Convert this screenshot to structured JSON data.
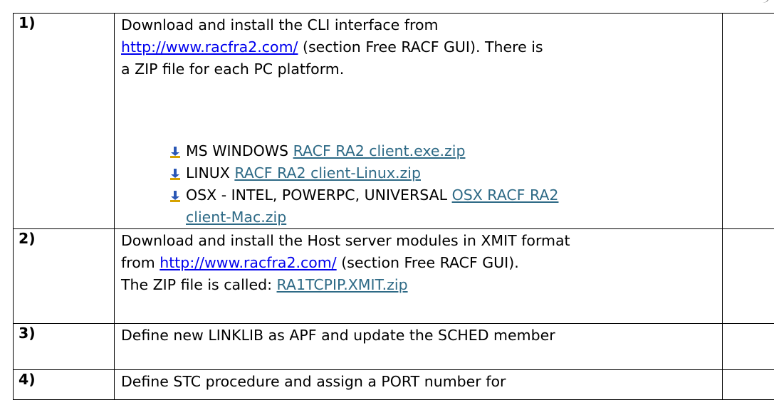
{
  "steps": [
    {
      "number": "1)",
      "text_pre": "Download and install the CLI interface from",
      "link": "http://www.racfra2.com/",
      "text_post": " (section Free RACF GUI).  There is",
      "text_line3": "a ZIP file for each PC platform.",
      "platforms": [
        {
          "label": "MS WINDOWS ",
          "link": "RACF RA2 client.exe.zip"
        },
        {
          "label": "LINUX ",
          "link": "RACF RA2 client-Linux.zip"
        },
        {
          "label": "OSX - INTEL, POWERPC, UNIVERSAL ",
          "link": "OSX RACF RA2",
          "link_cont": "client-Mac.zip"
        }
      ]
    },
    {
      "number": "2)",
      "line1": "Download and install the Host server modules in XMIT format",
      "line2_pre": "from ",
      "link": "http://www.racfra2.com/",
      "line2_post": " (section Free RACF GUI).",
      "line3_pre": "The ZIP file is called: ",
      "file_link": "RA1TCPIP.XMIT.zip"
    },
    {
      "number": "3)",
      "line1": "Define new LINKLIB as APF and update the SCHED member"
    },
    {
      "number": "4)",
      "line1": "Define STC procedure and assign a PORT number for"
    }
  ],
  "colors": {
    "link_blue": "#0000ee",
    "link_teal": "#2e6a86",
    "bullet_blue": "#2a57b5",
    "bullet_gold": "#d6a200"
  },
  "icons": {
    "bullet": "down-arrow-bullet-icon"
  }
}
